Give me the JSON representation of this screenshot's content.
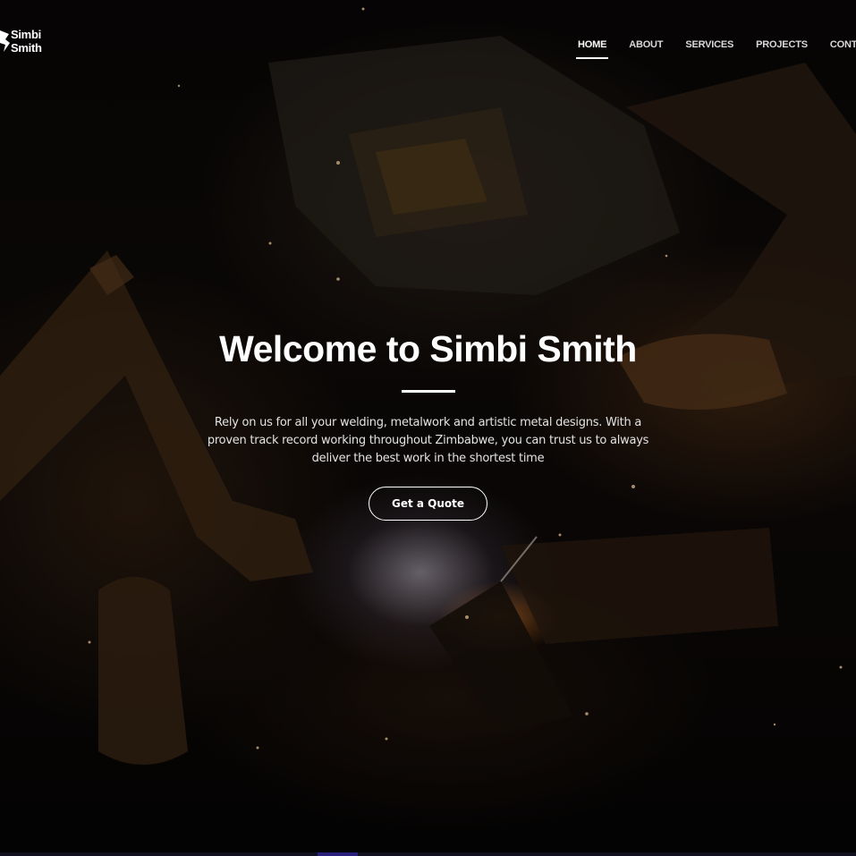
{
  "brand": {
    "name_line1": "Simbi",
    "name_line2": "Smith"
  },
  "nav": {
    "items": [
      {
        "label": "HOME",
        "active": true
      },
      {
        "label": "ABOUT",
        "active": false
      },
      {
        "label": "SERVICES",
        "active": false
      },
      {
        "label": "PROJECTS",
        "active": false
      },
      {
        "label": "CONTACT",
        "active": false
      }
    ]
  },
  "hero": {
    "title": "Welcome to Simbi Smith",
    "description": "Rely on us for all your welding, metalwork and artistic metal designs. With a proven track record working throughout Zimbabwe, you can trust us to always deliver the best work in the shortest time",
    "cta_label": "Get a Quote",
    "background_image": "welder-with-mask-sparks"
  },
  "colors": {
    "text": "#ffffff",
    "background": "#000000",
    "accent_strip": "#2a1f7a"
  }
}
